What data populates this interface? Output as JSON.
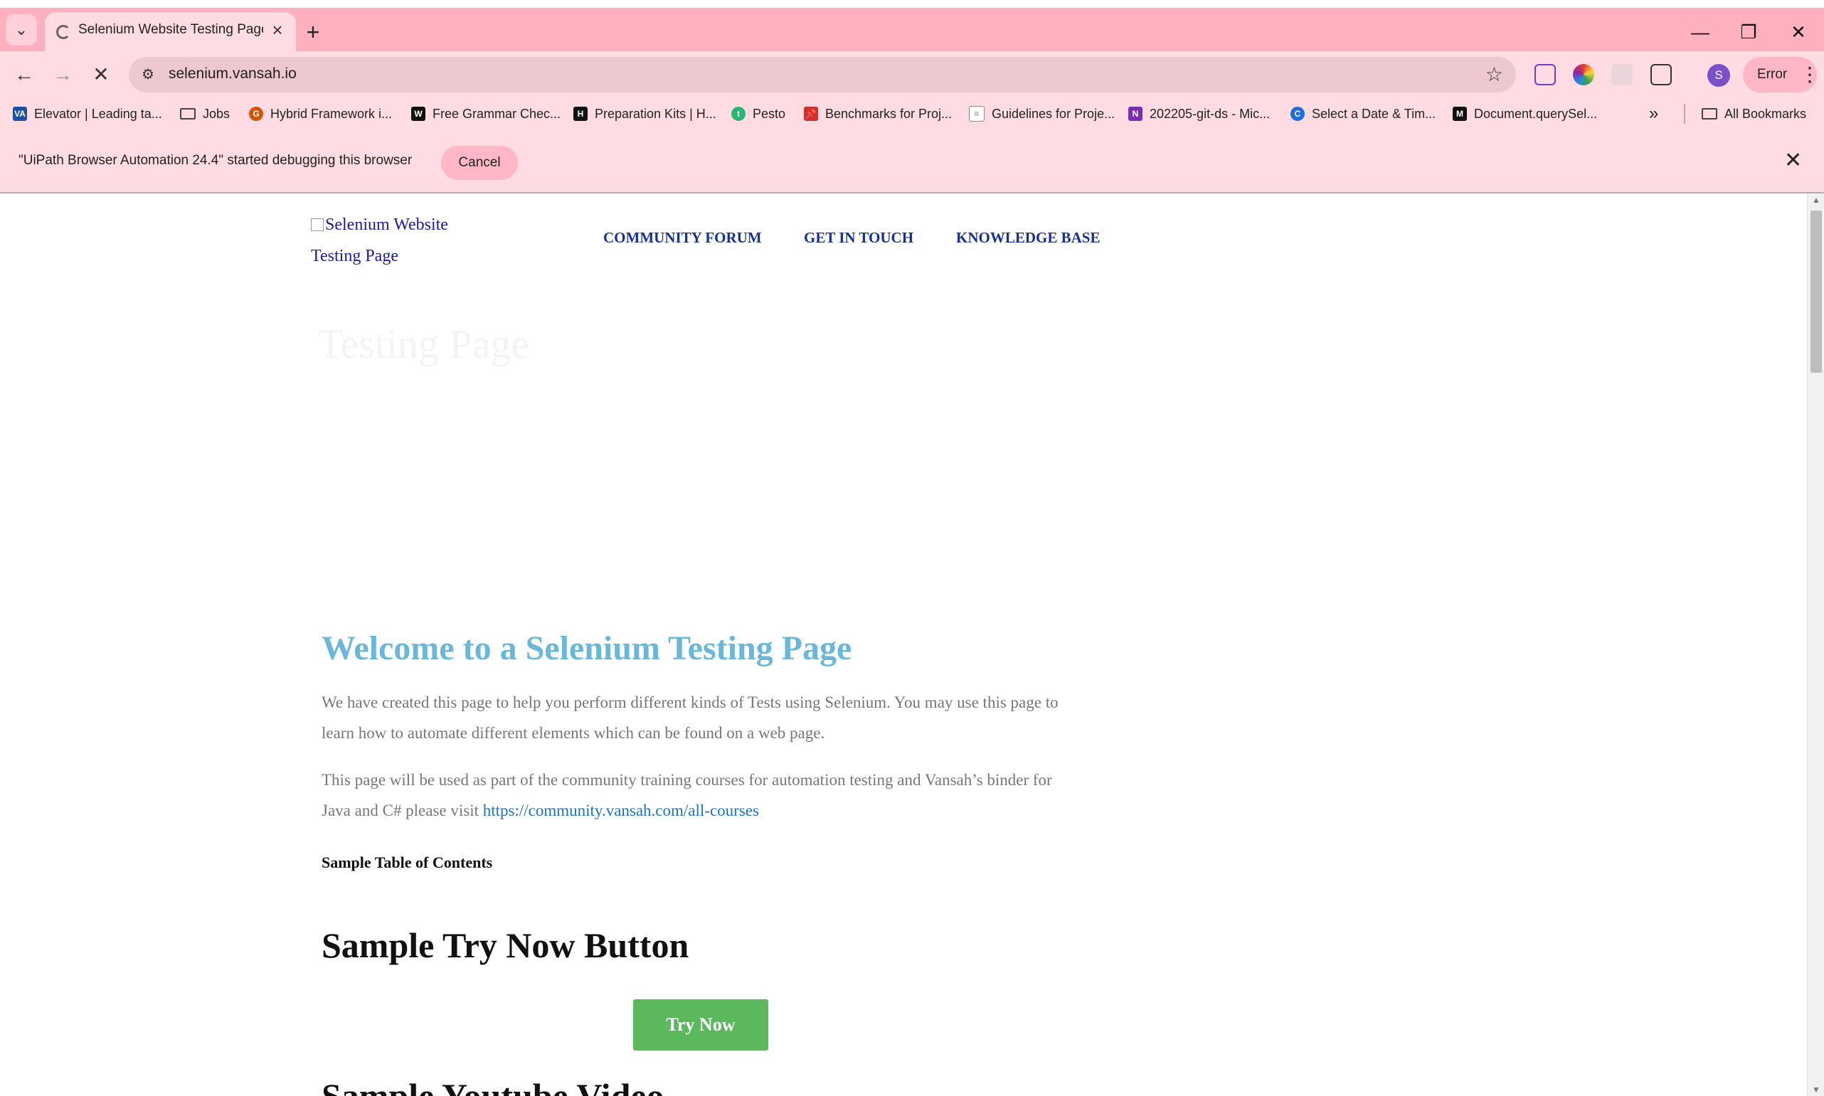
{
  "browser": {
    "tab_title": "Selenium Website Testing Page",
    "new_tab": "+",
    "url": "selenium.vansah.io",
    "profile_initial": "S",
    "error_label": "Error",
    "window": {
      "minimize": "—",
      "restore": "❐",
      "close": "✕"
    }
  },
  "bookmarks": {
    "items": [
      {
        "label": "Elevator | Leading ta...",
        "icon": "VA",
        "color": "#1b4fa0"
      },
      {
        "label": "Jobs",
        "icon": "folder"
      },
      {
        "label": "Hybrid Framework i...",
        "icon": "G",
        "color": "#d35400"
      },
      {
        "label": "Free Grammar Chec...",
        "icon": "W",
        "color": "#111111"
      },
      {
        "label": "Preparation Kits | H...",
        "icon": "H",
        "color": "#111111"
      },
      {
        "label": "Pesto",
        "icon": "t",
        "color": "#2bb673"
      },
      {
        "label": "Benchmarks for Proj...",
        "icon": "pin",
        "color": "#d32f2f"
      },
      {
        "label": "Guidelines for Proje...",
        "icon": "doc",
        "color": "#888888"
      },
      {
        "label": "202205-git-ds - Mic...",
        "icon": "N",
        "color": "#7b2fb0"
      },
      {
        "label": "Select a Date & Tim...",
        "icon": "C",
        "color": "#1e6fd9"
      },
      {
        "label": "Document.querySel...",
        "icon": "M",
        "color": "#111111"
      }
    ],
    "more": "»",
    "all_bookmarks": "All Bookmarks"
  },
  "infobar": {
    "message": "\"UiPath Browser Automation 24.4\" started debugging this browser",
    "cancel_label": "Cancel"
  },
  "page": {
    "logo_alt": "Selenium Website Testing Page",
    "nav": [
      "COMMUNITY FORUM",
      "GET IN TOUCH",
      "KNOWLEDGE BASE"
    ],
    "hero_ghost_text": "Testing Page",
    "welcome_title": "Welcome to a Selenium Testing Page",
    "para1": "We have created this page to help you perform different kinds of Tests using Selenium. You may use this page to learn how to automate different elements which can be found on a web page.",
    "para2_text": "This page will be used as part of the community training courses for automation testing and Vansah’s binder for Java and C# please visit ",
    "para2_link": "https://community.vansah.com/all-courses",
    "toc_label": "Sample Table of Contents",
    "section_try_now": "Sample Try Now Button",
    "try_now_label": "Try Now",
    "section_youtube": "Sample Youtube Video"
  },
  "colors": {
    "tabbar": "#ffb0bf",
    "toolbar": "#ffdbe3",
    "welcome_title": "#6ab7dc",
    "nav_link": "#15309a",
    "try_now_button": "#5cb85c"
  }
}
